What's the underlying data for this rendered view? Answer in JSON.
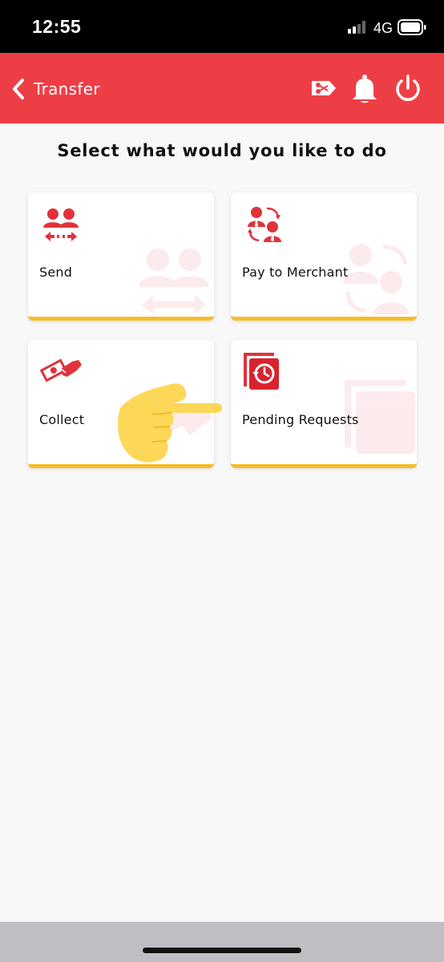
{
  "status_bar": {
    "time": "12:55",
    "network": "4G",
    "icons": [
      "signal-icon",
      "battery-icon"
    ]
  },
  "header": {
    "title": "Transfer",
    "background": "#ee3e45",
    "icons": [
      "back-chevron-icon",
      "coupon-scissors-icon",
      "bell-icon",
      "power-icon"
    ]
  },
  "main": {
    "prompt": "Select what would you like to do",
    "accent": "#f6bd29",
    "icon_color": "#e0323c",
    "cards": [
      {
        "label": "Send",
        "icon": "people-transfer-icon"
      },
      {
        "label": "Pay to Merchant",
        "icon": "merchant-exchange-icon"
      },
      {
        "label": "Collect",
        "icon": "cash-hand-icon"
      },
      {
        "label": "Pending Requests",
        "icon": "history-clock-icon"
      }
    ]
  },
  "overlay": {
    "icon": "pointing-hand-icon"
  }
}
